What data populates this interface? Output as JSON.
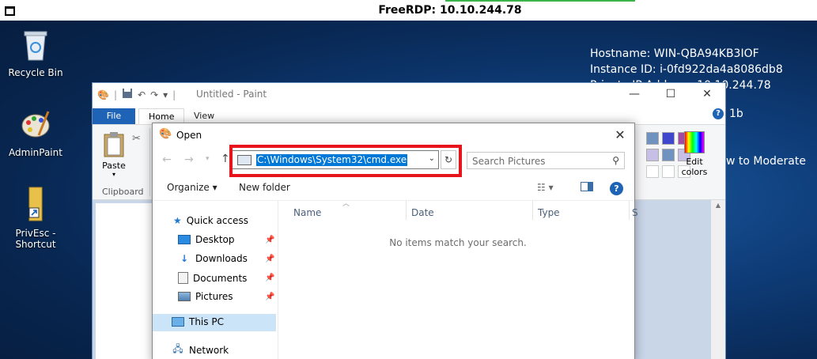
{
  "rdp": {
    "title": "FreeRDP: 10.10.244.78"
  },
  "bginfo": {
    "lines": [
      "Hostname: WIN-QBA94KB3IOF",
      "Instance ID: i-0fd922da4a8086db8",
      "Private IP Address: 10.10.244.78"
    ],
    "extra_1b": "1b",
    "extra_moderate": "w to Moderate"
  },
  "desktop": {
    "icons": [
      {
        "label": "Recycle Bin"
      },
      {
        "label": "AdminPaint"
      },
      {
        "label": "PrivEsc - Shortcut"
      }
    ]
  },
  "paint": {
    "title": "Untitled - Paint",
    "tabs": {
      "file": "File",
      "home": "Home",
      "view": "View"
    },
    "clipboard": {
      "paste": "Paste",
      "group": "Clipboard"
    },
    "edit_colors": "Edit colors",
    "palette": [
      "#7092be",
      "#3f48cc",
      "#a349a4",
      "#c8bfe7",
      "#7092be",
      "#c8bfe7",
      "#ffffff",
      "#ffffff",
      "#ffffff"
    ]
  },
  "dialog": {
    "title": "Open",
    "address_value": "C:\\Windows\\System32\\cmd.exe",
    "search_placeholder": "Search Pictures",
    "commands": {
      "organize": "Organize ▾",
      "new_folder": "New folder"
    },
    "nav": [
      {
        "label": "Quick access",
        "pinned": false
      },
      {
        "label": "Desktop",
        "pinned": true
      },
      {
        "label": "Downloads",
        "pinned": true
      },
      {
        "label": "Documents",
        "pinned": true
      },
      {
        "label": "Pictures",
        "pinned": true
      },
      {
        "label": "This PC",
        "pinned": false
      },
      {
        "label": "Network",
        "pinned": false
      }
    ],
    "columns": {
      "name": "Name",
      "date": "Date",
      "type": "Type",
      "size": "S"
    },
    "empty_message": "No items match your search."
  },
  "colors": {
    "highlight": "#e8141c",
    "selection": "#0078d7"
  }
}
